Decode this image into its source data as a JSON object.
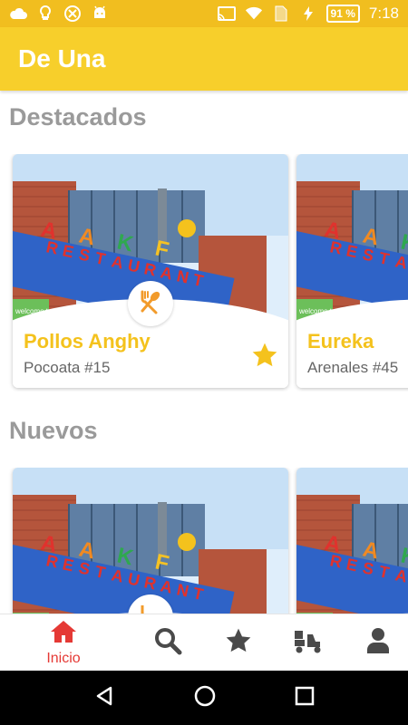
{
  "status_bar": {
    "battery": "91 %",
    "time": "7:18"
  },
  "app": {
    "title": "De Una"
  },
  "sections": [
    {
      "title": "Destacados",
      "cards": [
        {
          "name": "Pollos Anghy",
          "address": "Pocoata #15",
          "favorite": true
        },
        {
          "name": "Eureka",
          "address": "Arenales #45",
          "favorite": false
        }
      ]
    },
    {
      "title": "Nuevos",
      "cards": [
        {
          "name": "",
          "address": "",
          "favorite": false
        },
        {
          "name": "",
          "address": "",
          "favorite": false
        }
      ]
    }
  ],
  "image_sign": {
    "brand": "AAKF",
    "word": "RESTAURANT",
    "welcome": "welcome to"
  },
  "bottom_nav": {
    "items": [
      {
        "label": "Inicio",
        "icon": "home-icon",
        "active": true
      },
      {
        "label": "",
        "icon": "search-icon",
        "active": false
      },
      {
        "label": "",
        "icon": "star-icon",
        "active": false
      },
      {
        "label": "",
        "icon": "delivery-icon",
        "active": false
      },
      {
        "label": "",
        "icon": "user-icon",
        "active": false
      }
    ]
  },
  "colors": {
    "status_bar": "#F1BE1F",
    "app_bar": "#F7CF2B",
    "accent_yellow": "#F4C21D",
    "active_red": "#E53935",
    "nav_gray": "#4a4a4a",
    "section_gray": "#9a9a9a"
  }
}
